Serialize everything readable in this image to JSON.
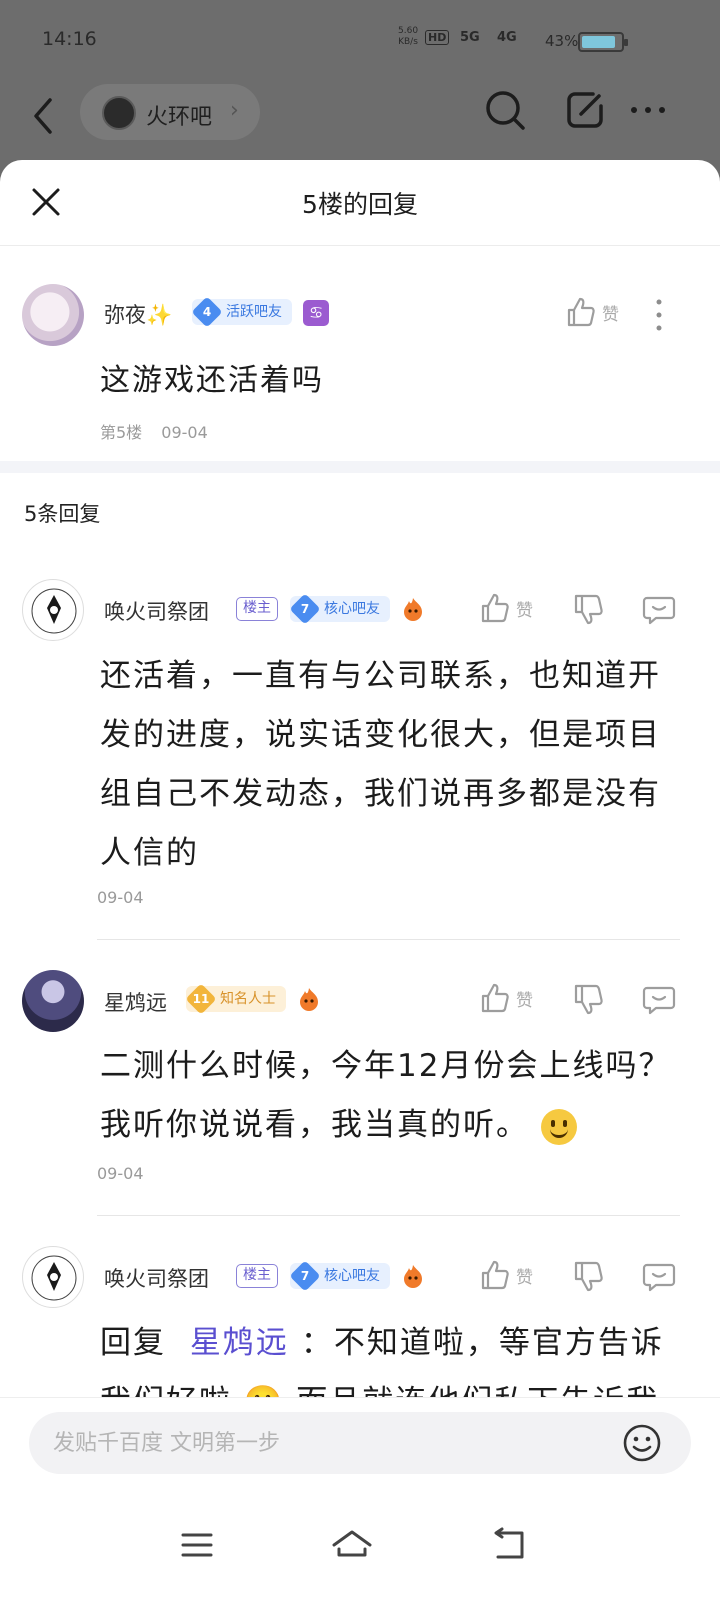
{
  "status_bar": {
    "time": "14:16",
    "net_speed": "5.60",
    "net_unit": "KB/s",
    "hd": "HD",
    "sig1": "5G",
    "sig2": "4G",
    "battery_pct": "43%",
    "battery_level": 0.43,
    "battery_color": "#7fc7dc"
  },
  "top_nav": {
    "forum_name": "火环吧"
  },
  "sheet": {
    "title": "5楼的回复"
  },
  "main_post": {
    "username": "弥夜✨",
    "level": "4",
    "level_title": "活跃吧友",
    "zodiac": "♋",
    "like_label": "赞",
    "content": "这游戏还活着吗",
    "floor": "第5楼",
    "date": "09-04"
  },
  "reply_count_label": "5条回复",
  "replies": [
    {
      "username": "唤火司祭团",
      "owner_badge": "楼主",
      "level": "7",
      "level_title": "核心吧友",
      "like_label": "赞",
      "content": "还活着，一直有与公司联系，也知道开发的进度，说实话变化很大，但是项目组自己不发动态，我们说再多都是没有人信的",
      "date": "09-04"
    },
    {
      "username": "星鸩远",
      "level": "11",
      "level_title": "知名人士",
      "like_label": "赞",
      "content": "二测什么时候，今年12月份会上线吗？我听你说说看，我当真的听。",
      "date": "09-04"
    },
    {
      "username": "唤火司祭团",
      "owner_badge": "楼主",
      "level": "7",
      "level_title": "核心吧友",
      "like_label": "赞",
      "reply_prefix": "回复",
      "mention": "星鸩远",
      "content": "：不知道啦，等官方告诉我们好啦 😬 而且就连他们私下告诉我"
    }
  ],
  "input": {
    "placeholder": "发贴千百度 文明第一步"
  },
  "colors": {
    "accent": "#5a4fd0",
    "badge_blue": "#4a8cf0",
    "badge_gold": "#f2b53b"
  }
}
